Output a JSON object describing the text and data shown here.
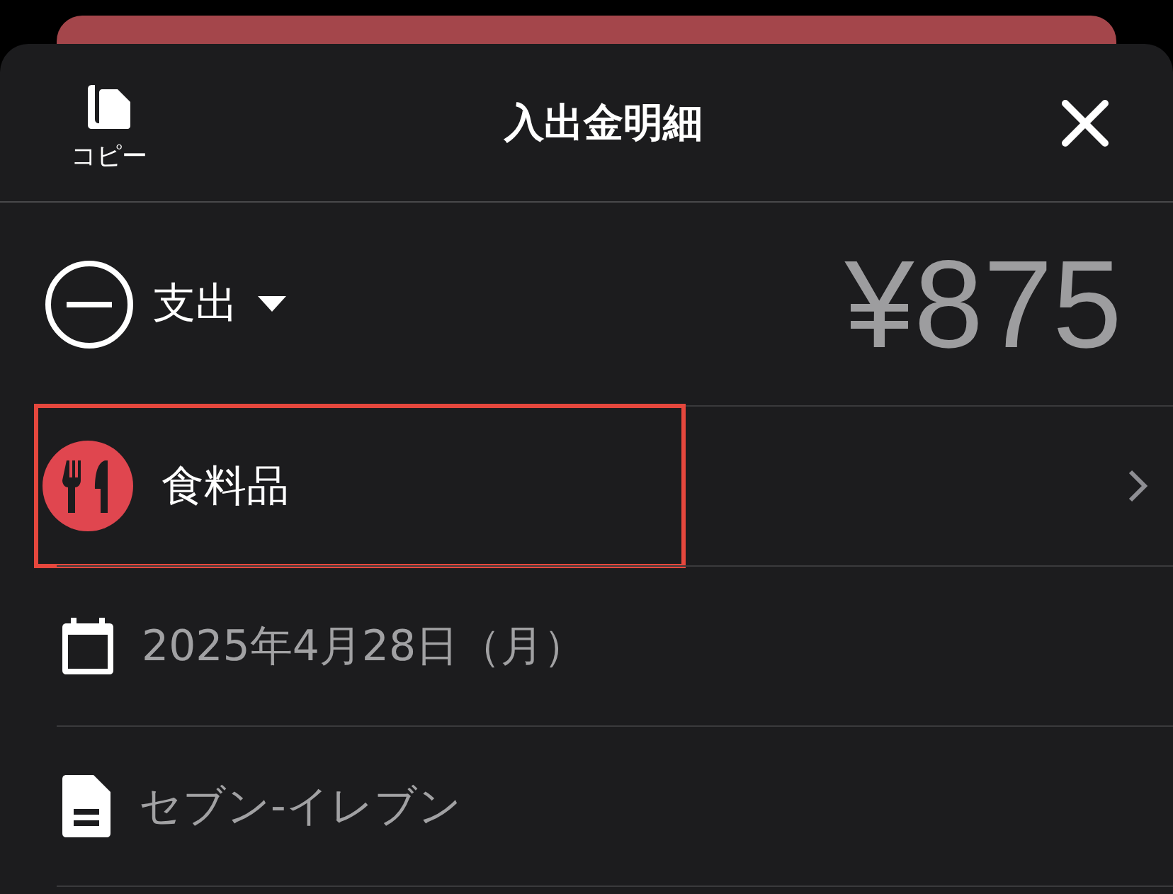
{
  "header": {
    "copy_label": "コピー",
    "title": "入出金明細"
  },
  "entry_type": {
    "kind": "expense",
    "label": "支出"
  },
  "amount": "¥875",
  "rows": [
    {
      "kind": "category",
      "label": "食料品",
      "highlighted": true
    },
    {
      "kind": "date",
      "label": "2025年4月28日（月）",
      "highlighted": false
    },
    {
      "kind": "memo",
      "label": "セブン-イレブン",
      "highlighted": false
    }
  ]
}
